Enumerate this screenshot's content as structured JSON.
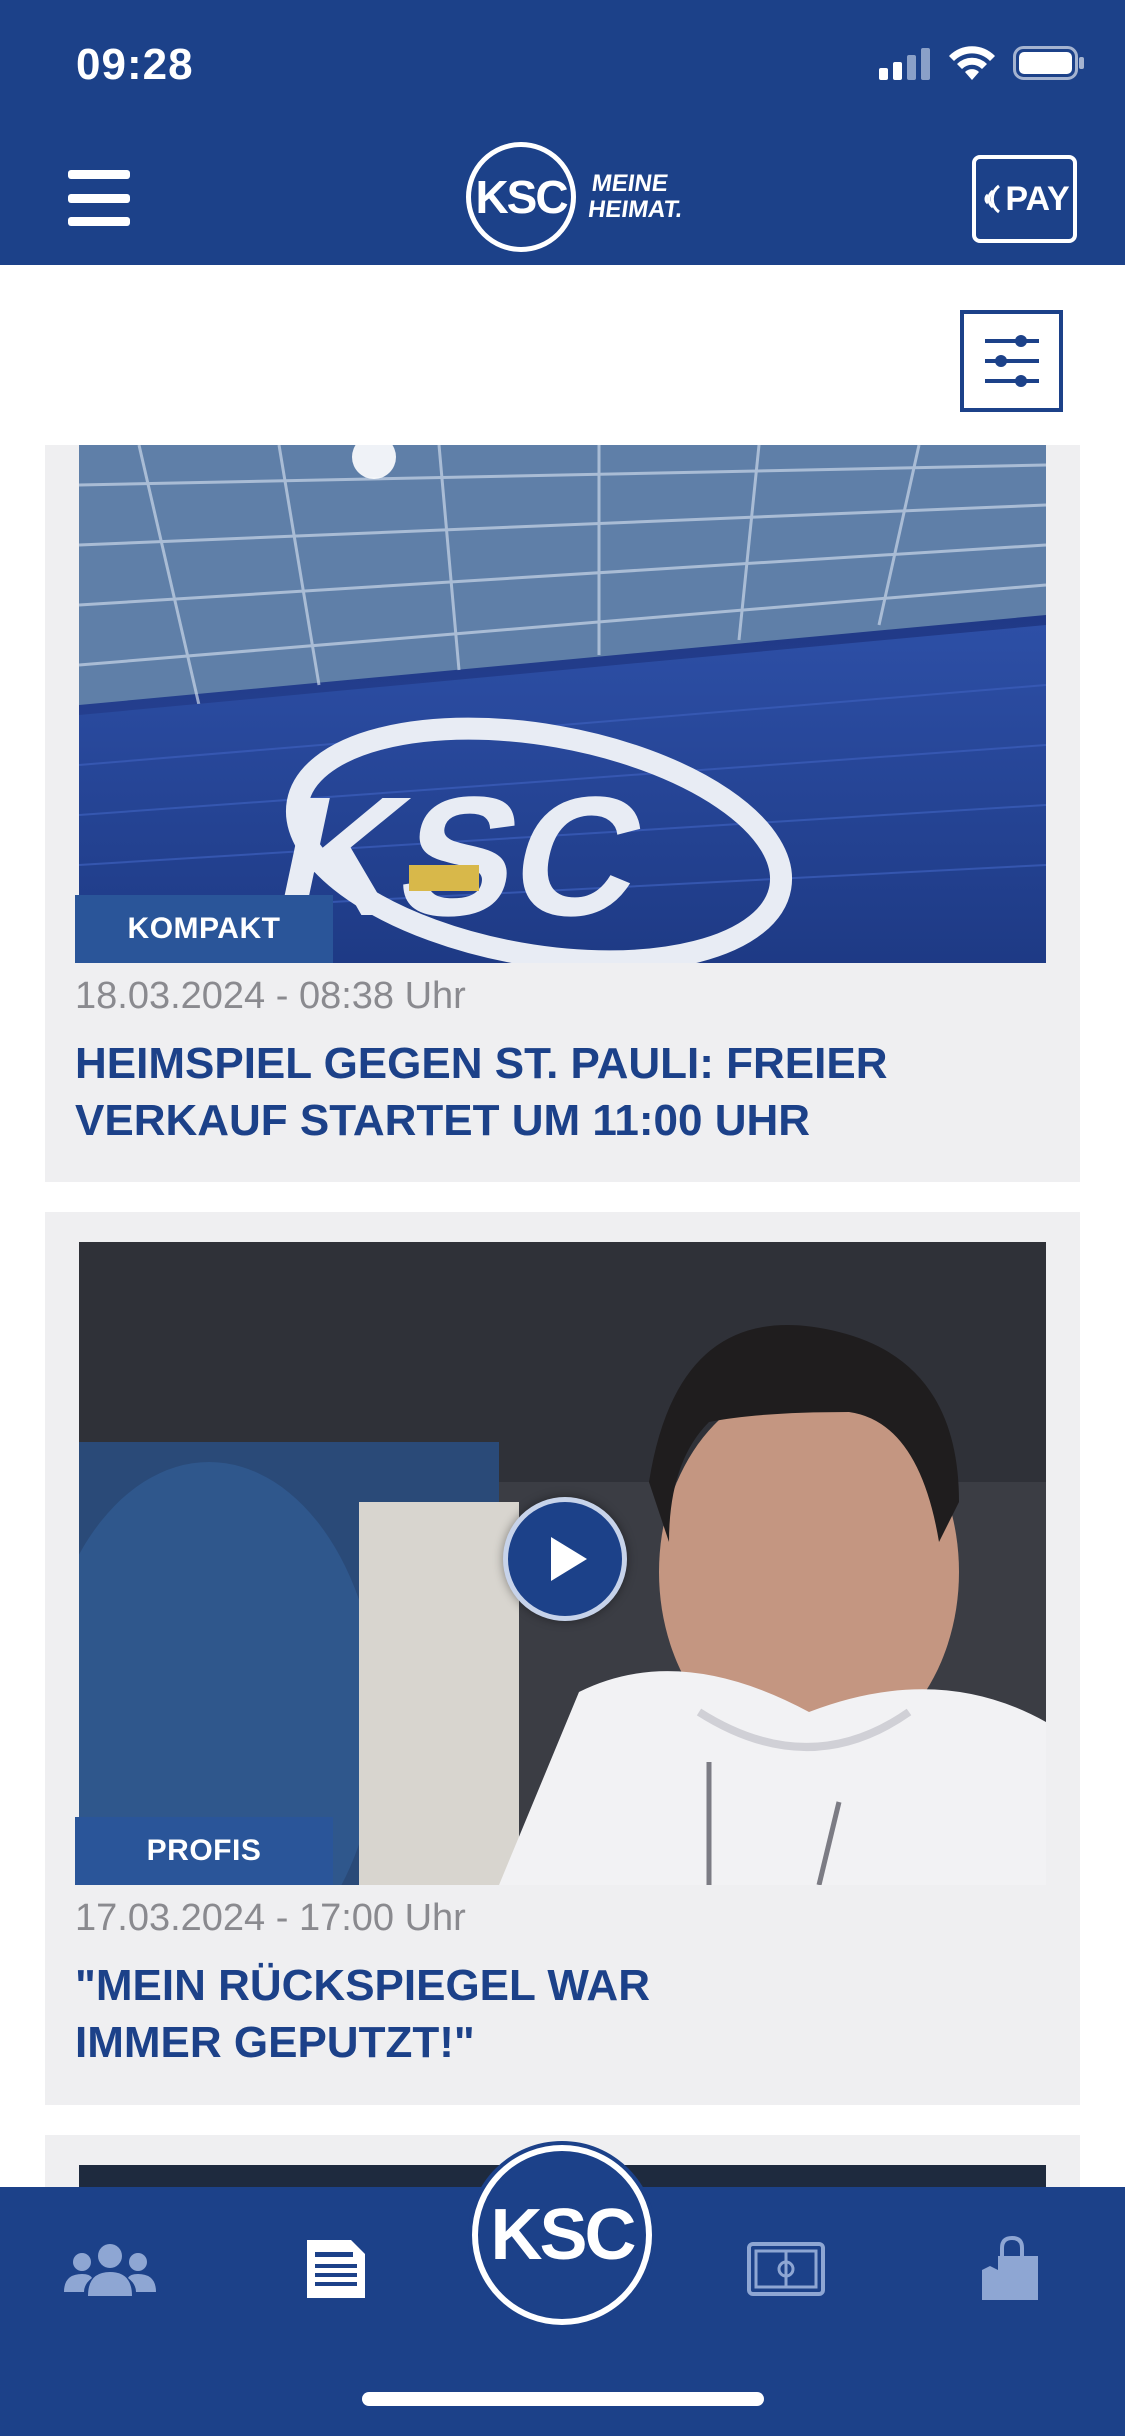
{
  "status_bar": {
    "time": "09:28"
  },
  "header": {
    "logo_text": "KSC",
    "logo_slogan_line1": "MEINE",
    "logo_slogan_line2": "HEIMAT.",
    "pay_label": "PAY"
  },
  "articles": [
    {
      "category": "KOMPAKT",
      "date": "18.03.2024 - 08:38 Uhr",
      "title": "HEIMSPIEL GEGEN ST. PAULI: FREIER VERKAUF STARTET UM 11:00 UHR",
      "has_video": false
    },
    {
      "category": "PROFIS",
      "date": "17.03.2024 - 17:00 Uhr",
      "title": "\"MEIN RÜCKSPIEGEL WAR IMMER GEPUTZT!\"",
      "has_video": true
    }
  ],
  "tabbar": {
    "center_logo": "KSC",
    "tabs": [
      {
        "icon": "team-icon"
      },
      {
        "icon": "news-icon"
      },
      {
        "icon": "ksc-logo-icon"
      },
      {
        "icon": "match-field-icon"
      },
      {
        "icon": "shop-icon"
      }
    ]
  },
  "colors": {
    "primary": "#1c4189",
    "badge": "#2a5599",
    "card_bg": "#efeff1",
    "date_text": "#8a8a8f"
  }
}
